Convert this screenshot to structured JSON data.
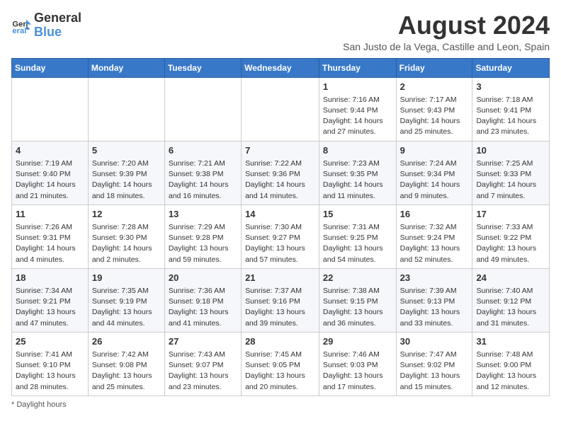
{
  "logo": {
    "line1": "General",
    "line2": "Blue"
  },
  "title": "August 2024",
  "subtitle": "San Justo de la Vega, Castille and Leon, Spain",
  "weekdays": [
    "Sunday",
    "Monday",
    "Tuesday",
    "Wednesday",
    "Thursday",
    "Friday",
    "Saturday"
  ],
  "weeks": [
    [
      {
        "day": "",
        "info": ""
      },
      {
        "day": "",
        "info": ""
      },
      {
        "day": "",
        "info": ""
      },
      {
        "day": "",
        "info": ""
      },
      {
        "day": "1",
        "info": "Sunrise: 7:16 AM\nSunset: 9:44 PM\nDaylight: 14 hours\nand 27 minutes."
      },
      {
        "day": "2",
        "info": "Sunrise: 7:17 AM\nSunset: 9:43 PM\nDaylight: 14 hours\nand 25 minutes."
      },
      {
        "day": "3",
        "info": "Sunrise: 7:18 AM\nSunset: 9:41 PM\nDaylight: 14 hours\nand 23 minutes."
      }
    ],
    [
      {
        "day": "4",
        "info": "Sunrise: 7:19 AM\nSunset: 9:40 PM\nDaylight: 14 hours\nand 21 minutes."
      },
      {
        "day": "5",
        "info": "Sunrise: 7:20 AM\nSunset: 9:39 PM\nDaylight: 14 hours\nand 18 minutes."
      },
      {
        "day": "6",
        "info": "Sunrise: 7:21 AM\nSunset: 9:38 PM\nDaylight: 14 hours\nand 16 minutes."
      },
      {
        "day": "7",
        "info": "Sunrise: 7:22 AM\nSunset: 9:36 PM\nDaylight: 14 hours\nand 14 minutes."
      },
      {
        "day": "8",
        "info": "Sunrise: 7:23 AM\nSunset: 9:35 PM\nDaylight: 14 hours\nand 11 minutes."
      },
      {
        "day": "9",
        "info": "Sunrise: 7:24 AM\nSunset: 9:34 PM\nDaylight: 14 hours\nand 9 minutes."
      },
      {
        "day": "10",
        "info": "Sunrise: 7:25 AM\nSunset: 9:33 PM\nDaylight: 14 hours\nand 7 minutes."
      }
    ],
    [
      {
        "day": "11",
        "info": "Sunrise: 7:26 AM\nSunset: 9:31 PM\nDaylight: 14 hours\nand 4 minutes."
      },
      {
        "day": "12",
        "info": "Sunrise: 7:28 AM\nSunset: 9:30 PM\nDaylight: 14 hours\nand 2 minutes."
      },
      {
        "day": "13",
        "info": "Sunrise: 7:29 AM\nSunset: 9:28 PM\nDaylight: 13 hours\nand 59 minutes."
      },
      {
        "day": "14",
        "info": "Sunrise: 7:30 AM\nSunset: 9:27 PM\nDaylight: 13 hours\nand 57 minutes."
      },
      {
        "day": "15",
        "info": "Sunrise: 7:31 AM\nSunset: 9:25 PM\nDaylight: 13 hours\nand 54 minutes."
      },
      {
        "day": "16",
        "info": "Sunrise: 7:32 AM\nSunset: 9:24 PM\nDaylight: 13 hours\nand 52 minutes."
      },
      {
        "day": "17",
        "info": "Sunrise: 7:33 AM\nSunset: 9:22 PM\nDaylight: 13 hours\nand 49 minutes."
      }
    ],
    [
      {
        "day": "18",
        "info": "Sunrise: 7:34 AM\nSunset: 9:21 PM\nDaylight: 13 hours\nand 47 minutes."
      },
      {
        "day": "19",
        "info": "Sunrise: 7:35 AM\nSunset: 9:19 PM\nDaylight: 13 hours\nand 44 minutes."
      },
      {
        "day": "20",
        "info": "Sunrise: 7:36 AM\nSunset: 9:18 PM\nDaylight: 13 hours\nand 41 minutes."
      },
      {
        "day": "21",
        "info": "Sunrise: 7:37 AM\nSunset: 9:16 PM\nDaylight: 13 hours\nand 39 minutes."
      },
      {
        "day": "22",
        "info": "Sunrise: 7:38 AM\nSunset: 9:15 PM\nDaylight: 13 hours\nand 36 minutes."
      },
      {
        "day": "23",
        "info": "Sunrise: 7:39 AM\nSunset: 9:13 PM\nDaylight: 13 hours\nand 33 minutes."
      },
      {
        "day": "24",
        "info": "Sunrise: 7:40 AM\nSunset: 9:12 PM\nDaylight: 13 hours\nand 31 minutes."
      }
    ],
    [
      {
        "day": "25",
        "info": "Sunrise: 7:41 AM\nSunset: 9:10 PM\nDaylight: 13 hours\nand 28 minutes."
      },
      {
        "day": "26",
        "info": "Sunrise: 7:42 AM\nSunset: 9:08 PM\nDaylight: 13 hours\nand 25 minutes."
      },
      {
        "day": "27",
        "info": "Sunrise: 7:43 AM\nSunset: 9:07 PM\nDaylight: 13 hours\nand 23 minutes."
      },
      {
        "day": "28",
        "info": "Sunrise: 7:45 AM\nSunset: 9:05 PM\nDaylight: 13 hours\nand 20 minutes."
      },
      {
        "day": "29",
        "info": "Sunrise: 7:46 AM\nSunset: 9:03 PM\nDaylight: 13 hours\nand 17 minutes."
      },
      {
        "day": "30",
        "info": "Sunrise: 7:47 AM\nSunset: 9:02 PM\nDaylight: 13 hours\nand 15 minutes."
      },
      {
        "day": "31",
        "info": "Sunrise: 7:48 AM\nSunset: 9:00 PM\nDaylight: 13 hours\nand 12 minutes."
      }
    ]
  ],
  "footer": {
    "daylight_label": "Daylight hours"
  }
}
